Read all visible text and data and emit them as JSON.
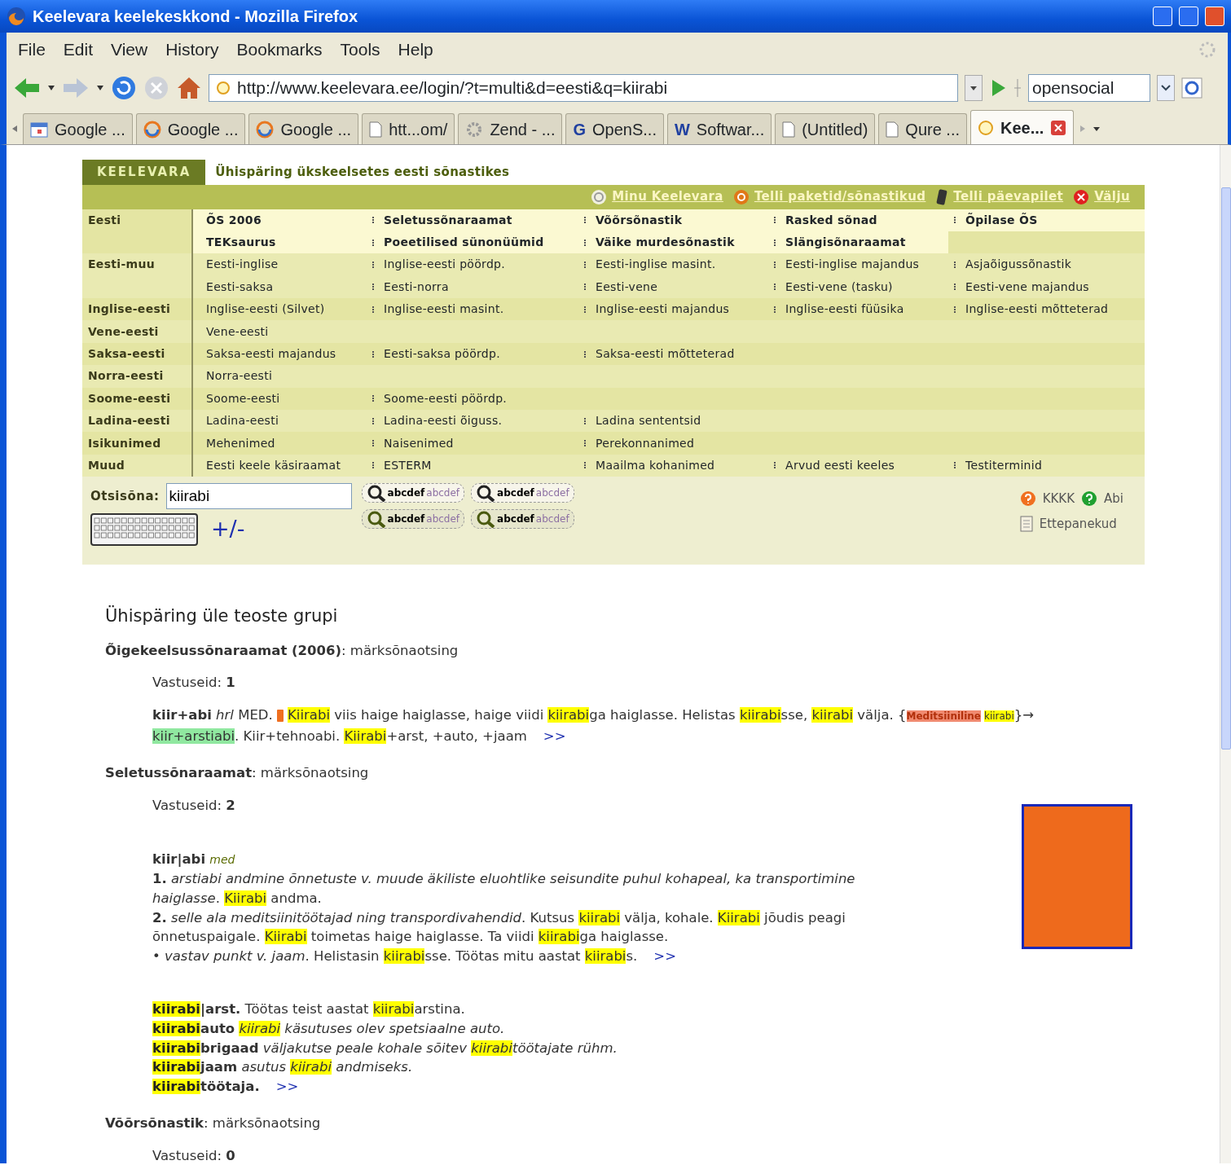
{
  "window": {
    "title": "Keelevara keelekeskkond - Mozilla Firefox"
  },
  "menu": [
    "File",
    "Edit",
    "View",
    "History",
    "Bookmarks",
    "Tools",
    "Help"
  ],
  "toolbar": {
    "url": "http://www.keelevara.ee/login/?t=multi&d=eesti&q=kiirabi",
    "search_engine": "opensocial"
  },
  "tabs": [
    {
      "label": "Google ...",
      "kind": "calendar",
      "selected": false
    },
    {
      "label": "Google ...",
      "kind": "swirl",
      "selected": false
    },
    {
      "label": "Google ...",
      "kind": "swirl",
      "selected": false
    },
    {
      "label": "htt...om/",
      "kind": "page",
      "selected": false
    },
    {
      "label": "Zend - ...",
      "kind": "gear",
      "selected": false
    },
    {
      "label": "OpenS...",
      "kind": "letter",
      "letter": "G",
      "selected": false
    },
    {
      "label": "Softwar...",
      "kind": "letter",
      "letter": "W",
      "selected": false
    },
    {
      "label": "(Untitled)",
      "kind": "page",
      "selected": false
    },
    {
      "label": "Qure ...",
      "kind": "page",
      "selected": false
    },
    {
      "label": "Kee...",
      "kind": "site",
      "selected": true
    }
  ],
  "site": {
    "logo": "KEELEVARA",
    "title": "Ühispäring ükskeelsetes eesti sõnastikes",
    "user_links": [
      {
        "label": "Minu Keelevara",
        "kind": "swirl"
      },
      {
        "label": "Telli paketid/sõnastikud",
        "kind": "coin"
      },
      {
        "label": "Telli päevapilet",
        "kind": "phone"
      },
      {
        "label": "Välju",
        "kind": "exit"
      }
    ]
  },
  "dictionaries": [
    {
      "label": "Eesti",
      "selected": true,
      "rows": [
        [
          "ÕS 2006",
          "Seletussõnaraamat",
          "Võõrsõnastik",
          "Rasked sõnad",
          "Õpilase ÕS"
        ],
        [
          "TEKsaurus",
          "Poeetilised sünonüümid",
          "Väike murdesõnastik",
          "Slängisõnaraamat"
        ]
      ]
    },
    {
      "label": "Eesti-muu",
      "selected": false,
      "rows": [
        [
          "Eesti-inglise",
          "Inglise-eesti pöördp.",
          "Eesti-inglise masint.",
          "Eesti-inglise majandus",
          "Asjaõigussõnastik"
        ],
        [
          "Eesti-saksa",
          "Eesti-norra",
          "Eesti-vene",
          "Eesti-vene (tasku)",
          "Eesti-vene majandus"
        ]
      ]
    },
    {
      "label": "Inglise-eesti",
      "selected": false,
      "rows": [
        [
          "Inglise-eesti (Silvet)",
          "Inglise-eesti masint.",
          "Inglise-eesti majandus",
          "Inglise-eesti füüsika",
          "Inglise-eesti mõtteterad"
        ]
      ]
    },
    {
      "label": "Vene-eesti",
      "selected": false,
      "rows": [
        [
          "Vene-eesti"
        ]
      ]
    },
    {
      "label": "Saksa-eesti",
      "selected": false,
      "rows": [
        [
          "Saksa-eesti majandus",
          "Eesti-saksa pöördp.",
          "Saksa-eesti mõtteterad"
        ]
      ]
    },
    {
      "label": "Norra-eesti",
      "selected": false,
      "rows": [
        [
          "Norra-eesti"
        ]
      ]
    },
    {
      "label": "Soome-eesti",
      "selected": false,
      "rows": [
        [
          "Soome-eesti",
          "Soome-eesti pöördp."
        ]
      ]
    },
    {
      "label": "Ladina-eesti",
      "selected": false,
      "rows": [
        [
          "Ladina-eesti",
          "Ladina-eesti õiguss.",
          "Ladina sententsid"
        ]
      ]
    },
    {
      "label": "Isikunimed",
      "selected": false,
      "rows": [
        [
          "Mehenimed",
          "Naisenimed",
          "Perekonnanimed"
        ]
      ]
    },
    {
      "label": "Muud",
      "selected": false,
      "rows": [
        [
          "Eesti keele käsiraamat",
          "ESTERM",
          "Maailma kohanimed",
          "Arvud eesti keeles",
          "Testiterminid"
        ]
      ]
    }
  ],
  "search": {
    "label": "Otsisõna:",
    "value": "kiirabi",
    "toggle": "+/-",
    "buttons": [
      {
        "label": "abcdef",
        "faded": "abcdef",
        "active": true
      },
      {
        "label": "abcdef",
        "faded": "abcdef",
        "active": true
      },
      {
        "label": "abcdef",
        "faded": "abcdef",
        "active": false
      },
      {
        "label": "abcdef",
        "faded": "abcdef",
        "active": false
      }
    ],
    "help_links": [
      {
        "label": "KKKK",
        "kind": "question-orange"
      },
      {
        "label": "Abi",
        "kind": "question-green"
      },
      {
        "label": "Ettepanekud",
        "kind": "note"
      }
    ]
  },
  "results": {
    "heading": "Ühispäring üle teoste grupi",
    "sections": [
      {
        "title": "**Õigekeelsussõnaraamat (2006)**: märksõnaotsing",
        "count": "Vastuseid: **1**",
        "groups": [
          [
            {
              "runs": [
                {
                  "kind": "text",
                  "text": "**kiir+abi** *hrl* MED. "
                },
                {
                  "kind": "marker"
                },
                {
                  "kind": "highlight",
                  "text": "Kiirabi"
                },
                {
                  "kind": "text",
                  "text": " viis haige haiglasse, haige viidi "
                },
                {
                  "kind": "highlight",
                  "text": "kiirabi"
                },
                {
                  "kind": "text",
                  "text": "ga haiglasse. Helistas "
                },
                {
                  "kind": "highlight",
                  "text": "kiirabi"
                },
                {
                  "kind": "text",
                  "text": "sse, "
                },
                {
                  "kind": "highlight",
                  "text": "kiirabi"
                },
                {
                  "kind": "text",
                  "text": " välja. {"
                },
                {
                  "kind": "tag",
                  "text": "Meditsiiniline"
                },
                {
                  "kind": "highlight",
                  "text": "kiirabi",
                  "small": true
                },
                {
                  "kind": "text",
                  "text": "}→ "
                },
                {
                  "kind": "link",
                  "text": "kiir+arstiabi"
                },
                {
                  "kind": "text",
                  "text": ". Kiir+tehnoabi. "
                },
                {
                  "kind": "highlight",
                  "text": "Kiirabi"
                },
                {
                  "kind": "text",
                  "text": "+arst, +auto, +jaam"
                }
              ],
              "more": ">>"
            }
          ]
        ]
      },
      {
        "title": "**Seletussõnaraamat**: märksõnaotsing",
        "count": "Vastuseid: **2**",
        "cover_photo": true,
        "groups": [
          [
            {
              "runs": [
                {
                  "kind": "text",
                  "text": "**kiir|abi** "
                },
                {
                  "kind": "label",
                  "text": "med"
                }
              ]
            },
            {
              "runs": [
                {
                  "kind": "text",
                  "text": "**1.** *arstiabi andmine õnnetuste v. muude äkiliste eluohtlike seisundite puhul kohapeal, ka transportimine haiglasse*. "
                },
                {
                  "kind": "highlight",
                  "text": "Kiirabi"
                },
                {
                  "kind": "text",
                  "text": " andma."
                }
              ]
            },
            {
              "runs": [
                {
                  "kind": "text",
                  "text": "**2.** *selle ala meditsiinitöötajad ning transpordivahendid*. Kutsus "
                },
                {
                  "kind": "highlight",
                  "text": "kiirabi"
                },
                {
                  "kind": "text",
                  "text": " välja, kohale. "
                },
                {
                  "kind": "highlight",
                  "text": "Kiirabi"
                },
                {
                  "kind": "text",
                  "text": " jõudis peagi õnnetuspaigale. "
                },
                {
                  "kind": "highlight",
                  "text": "Kiirabi"
                },
                {
                  "kind": "text",
                  "text": " toimetas haige haiglasse. Ta viidi "
                },
                {
                  "kind": "highlight",
                  "text": "kiirabi"
                },
                {
                  "kind": "text",
                  "text": "ga haiglasse."
                }
              ]
            },
            {
              "runs": [
                {
                  "kind": "text",
                  "text": "• *vastav punkt v. jaam*. Helistasin "
                },
                {
                  "kind": "highlight",
                  "text": "kiirabi"
                },
                {
                  "kind": "text",
                  "text": "sse. Töötas mitu aastat "
                },
                {
                  "kind": "highlight",
                  "text": "kiirabi"
                },
                {
                  "kind": "text",
                  "text": "s."
                }
              ],
              "more": ">>"
            }
          ],
          [
            {
              "runs": [
                {
                  "kind": "highlight",
                  "text": "kiirabi",
                  "bold": true
                },
                {
                  "kind": "text",
                  "text": "**|arst.** Töötas teist aastat "
                },
                {
                  "kind": "highlight",
                  "text": "kiirabi"
                },
                {
                  "kind": "text",
                  "text": "arstina."
                }
              ]
            },
            {
              "runs": [
                {
                  "kind": "highlight",
                  "text": "kiirabi",
                  "bold": true
                },
                {
                  "kind": "text",
                  "text": "**auto** "
                },
                {
                  "kind": "highlight",
                  "text": "kiirabi",
                  "italic": true
                },
                {
                  "kind": "text",
                  "text": " *käsutuses olev spetsiaalne auto.*"
                }
              ]
            },
            {
              "runs": [
                {
                  "kind": "highlight",
                  "text": "kiirabi",
                  "bold": true
                },
                {
                  "kind": "text",
                  "text": "**brigaad** *väljakutse peale kohale sõitev* "
                },
                {
                  "kind": "highlight",
                  "text": "kiirabi",
                  "italic": true
                },
                {
                  "kind": "text",
                  "text": "*töötajate rühm.*"
                }
              ]
            },
            {
              "runs": [
                {
                  "kind": "highlight",
                  "text": "kiirabi",
                  "bold": true
                },
                {
                  "kind": "text",
                  "text": "**jaam** *asutus* "
                },
                {
                  "kind": "highlight",
                  "text": "kiirabi",
                  "italic": true
                },
                {
                  "kind": "text",
                  "text": " *andmiseks.*"
                }
              ]
            },
            {
              "runs": [
                {
                  "kind": "highlight",
                  "text": "kiirabi",
                  "bold": true
                },
                {
                  "kind": "text",
                  "text": "**töötaja.**"
                }
              ],
              "more": ">>"
            }
          ]
        ]
      },
      {
        "title": "**Võõrsõnastik**: märksõnaotsing",
        "count": "Vastuseid: **0**"
      }
    ]
  }
}
